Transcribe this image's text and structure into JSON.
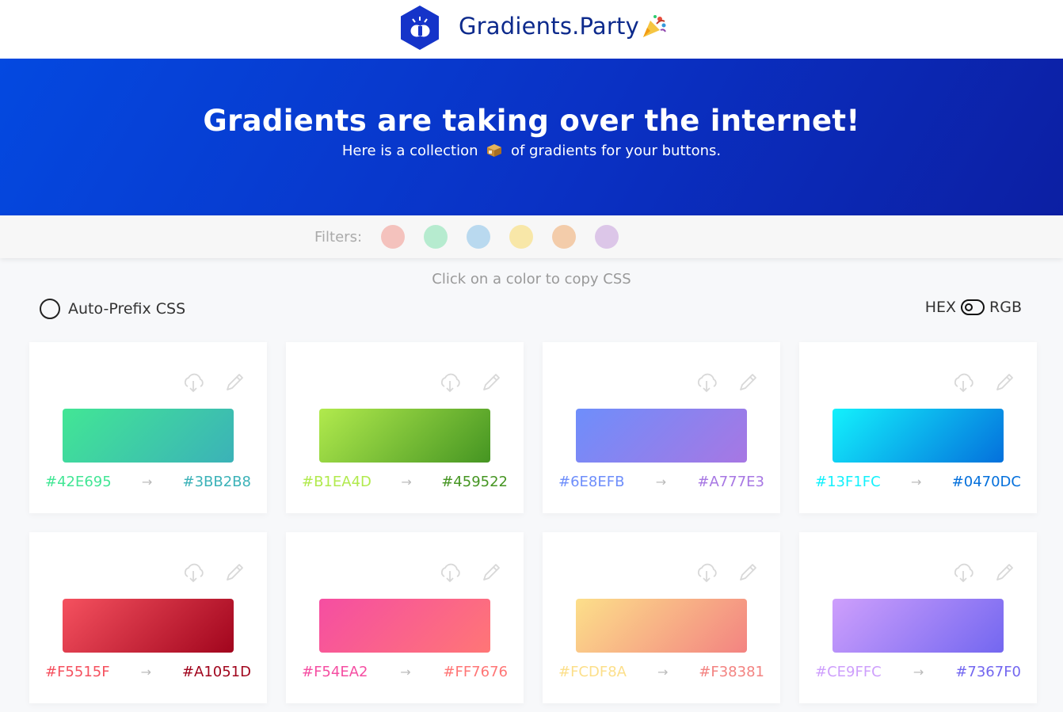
{
  "header": {
    "brand": "Gradients.Party"
  },
  "hero": {
    "title": "Gradients are taking over the internet!",
    "subtitle_before": "Here is a collection",
    "subtitle_after": "of gradients for your buttons."
  },
  "filters": {
    "label": "Filters:",
    "colors": [
      "#f4c2bd",
      "#b6ebcf",
      "#b9d9ef",
      "#f8e7a8",
      "#f3ccaa",
      "#dcc6e8"
    ]
  },
  "hint": "Click on a color to copy CSS",
  "controls": {
    "autoprefix_label": "Auto-Prefix CSS",
    "hex_label": "HEX",
    "rgb_label": "RGB"
  },
  "arrow": "→",
  "gradients": [
    {
      "from": "#42E695",
      "to": "#3BB2B8"
    },
    {
      "from": "#B1EA4D",
      "to": "#459522"
    },
    {
      "from": "#6E8EFB",
      "to": "#A777E3"
    },
    {
      "from": "#13F1FC",
      "to": "#0470DC"
    },
    {
      "from": "#F5515F",
      "to": "#A1051D"
    },
    {
      "from": "#F54EA2",
      "to": "#FF7676"
    },
    {
      "from": "#FCDF8A",
      "to": "#F38381"
    },
    {
      "from": "#CE9FFC",
      "to": "#7367F0"
    }
  ]
}
